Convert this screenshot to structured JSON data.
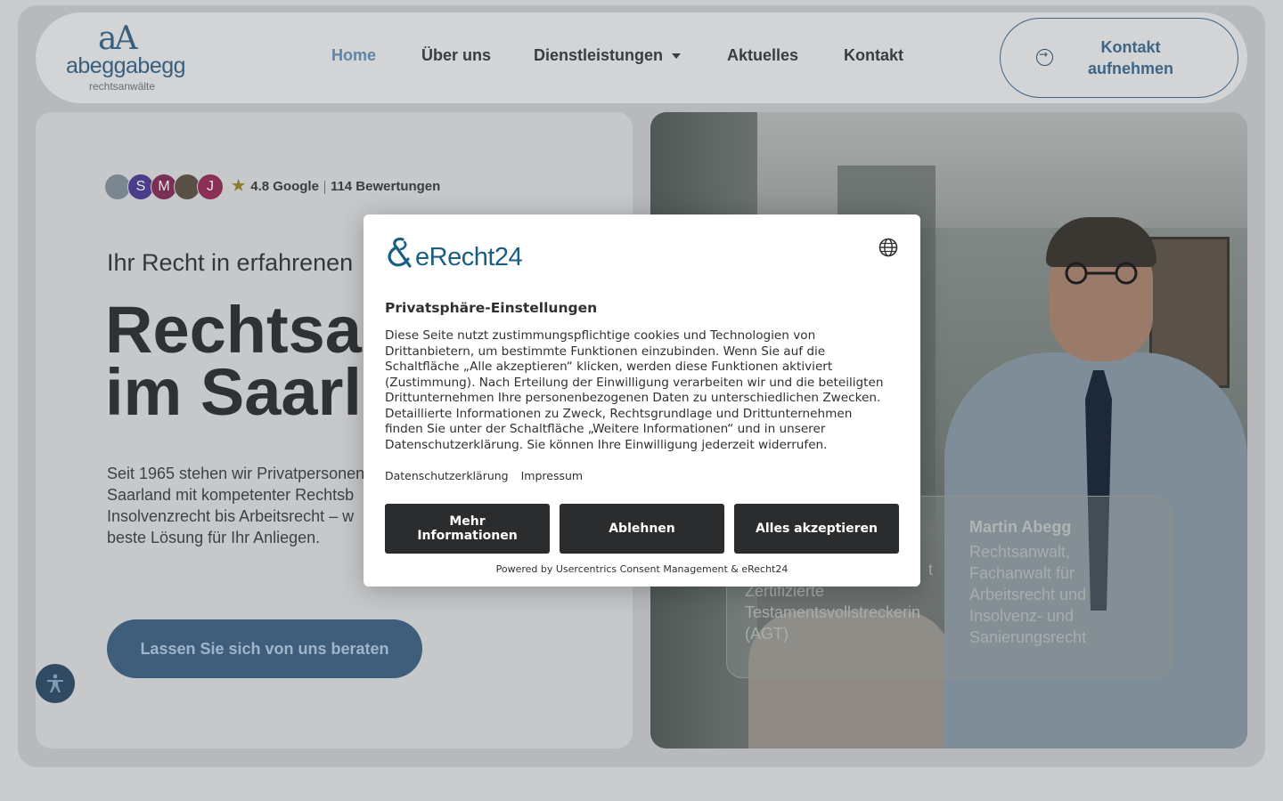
{
  "header": {
    "logo": {
      "mark": "aA",
      "name": "abeggabegg",
      "sub": "rechtsanwälte"
    },
    "nav": [
      {
        "label": "Home",
        "active": true
      },
      {
        "label": "Über uns",
        "active": false
      },
      {
        "label": "Dienstleistungen",
        "active": false,
        "has_dropdown": true
      },
      {
        "label": "Aktuelles",
        "active": false
      },
      {
        "label": "Kontakt",
        "active": false
      }
    ],
    "cta": {
      "label_line1": "Kontakt",
      "label_line2": "aufnehmen",
      "icon": "arrow-right-circle-icon"
    }
  },
  "hero": {
    "avatars": [
      {
        "letter": "",
        "color": "#7a8690"
      },
      {
        "letter": "S",
        "color": "#4b3d8a"
      },
      {
        "letter": "M",
        "color": "#7a2f55"
      },
      {
        "letter": "",
        "color": "#5a5046"
      },
      {
        "letter": "J",
        "color": "#8a2f55"
      }
    ],
    "rating": {
      "score": "4.8 Google",
      "reviews": "114 Bewertungen"
    },
    "eyebrow": "Ihr Recht in erfahrenen",
    "headline_line1": "Rechtsa",
    "headline_line2": "im Saarl",
    "lead_lines": [
      "Seit 1965 stehen wir Privatpersonen",
      "Saarland mit kompetenter Rechtsb",
      "Insolvenzrecht bis Arbeitsrecht – w",
      "beste Lösung für Ihr Anliegen."
    ],
    "cta_label": "Lassen Sie sich von uns beraten"
  },
  "people": {
    "left": {
      "lines": [
        "t",
        "Zertifizierte",
        "Testamentsvollstreckerin",
        "(AGT)"
      ]
    },
    "right": {
      "name": "Martin Abegg",
      "lines": [
        "Rechtsanwalt,",
        "Fachanwalt für",
        "Arbeitsrecht und",
        "Insolvenz- und",
        "Sanierungsrecht"
      ]
    }
  },
  "consent": {
    "brand": "eRecht24",
    "title": "Privatsphäre-Einstellungen",
    "text_lines": [
      "Diese Seite nutzt zustimmungspflichtige cookies und Technologien von",
      "Drittanbietern, um bestimmte Funktionen einzubinden. Wenn Sie auf die",
      "Schaltfläche „Alle akzeptieren“ klicken, werden diese Funktionen aktiviert",
      "(Zustimmung). Nach Erteilung der Einwilligung verarbeiten wir und die beteiligten",
      "Drittunternehmen Ihre personenbezogenen Daten zu unterschiedlichen Zwecken.",
      "Detaillierte Informationen zu Zweck, Rechtsgrundlage und Drittunternehmen",
      "finden Sie unter der Schaltfläche „Weitere Informationen“ und in unserer",
      "Datenschutzerklärung. Sie können Ihre Einwilligung jederzeit widerrufen."
    ],
    "links": {
      "privacy": "Datenschutzerklärung",
      "imprint": "Impressum"
    },
    "buttons": {
      "more_line1": "Mehr",
      "more_line2": "Informationen",
      "decline": "Ablehnen",
      "accept": "Alles akzeptieren"
    },
    "footer": "Powered by Usercentrics Consent Management & eRecht24"
  },
  "colors": {
    "accent": "#3f6586",
    "brand_consent": "#1a5e83",
    "button_dark": "#2b2c2e"
  }
}
